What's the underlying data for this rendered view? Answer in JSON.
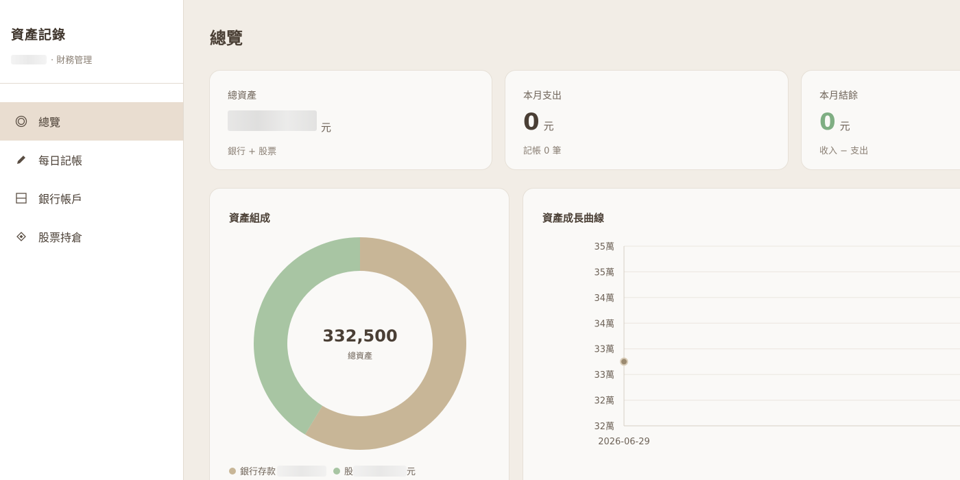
{
  "sidebar": {
    "title": "資產記錄",
    "subtitle": "· 財務管理",
    "nav": [
      {
        "label": "總覽",
        "icon": "target-icon",
        "active": true
      },
      {
        "label": "每日記帳",
        "icon": "pencil-icon",
        "active": false
      },
      {
        "label": "銀行帳戶",
        "icon": "bank-box-icon",
        "active": false
      },
      {
        "label": "股票持倉",
        "icon": "diamond-icon",
        "active": false
      }
    ]
  },
  "page": {
    "title": "總覽"
  },
  "stats": {
    "total": {
      "label": "總資產",
      "unit": "元",
      "note": "銀行 + 股票"
    },
    "expense": {
      "label": "本月支出",
      "value": "0",
      "unit": "元",
      "note": "記帳 0 筆"
    },
    "balance": {
      "label": "本月結餘",
      "value": "0",
      "unit": "元",
      "note": "收入 − 支出"
    }
  },
  "composition": {
    "title": "資產組成",
    "total": "332,500",
    "total_label": "總資產",
    "legend": [
      {
        "label": "銀行存款",
        "color": "#c8b697"
      },
      {
        "label": "股",
        "color": "#a8c5a3",
        "unit": "元"
      }
    ]
  },
  "colors": {
    "accent_active": "#e9ddd0",
    "green": "#7fae83",
    "tan": "#c8b697",
    "sage": "#a8c5a3"
  },
  "chart_data": [
    {
      "type": "pie",
      "title": "資產組成",
      "labels": [
        "銀行存款",
        "股票"
      ],
      "values": [
        195000,
        137500
      ],
      "colors": [
        "#c8b697",
        "#a8c5a3"
      ],
      "center_text": "332,500"
    },
    {
      "type": "line",
      "title": "資產成長曲線",
      "x": [
        "2026-06-29"
      ],
      "series": [
        {
          "values": [
            332500
          ],
          "color": "#b3a184"
        }
      ],
      "yticks": [
        "35萬",
        "35萬",
        "34萬",
        "34萬",
        "33萬",
        "33萬",
        "32萬",
        "32萬"
      ],
      "ylim": [
        320000,
        355000
      ],
      "grid": true
    }
  ]
}
